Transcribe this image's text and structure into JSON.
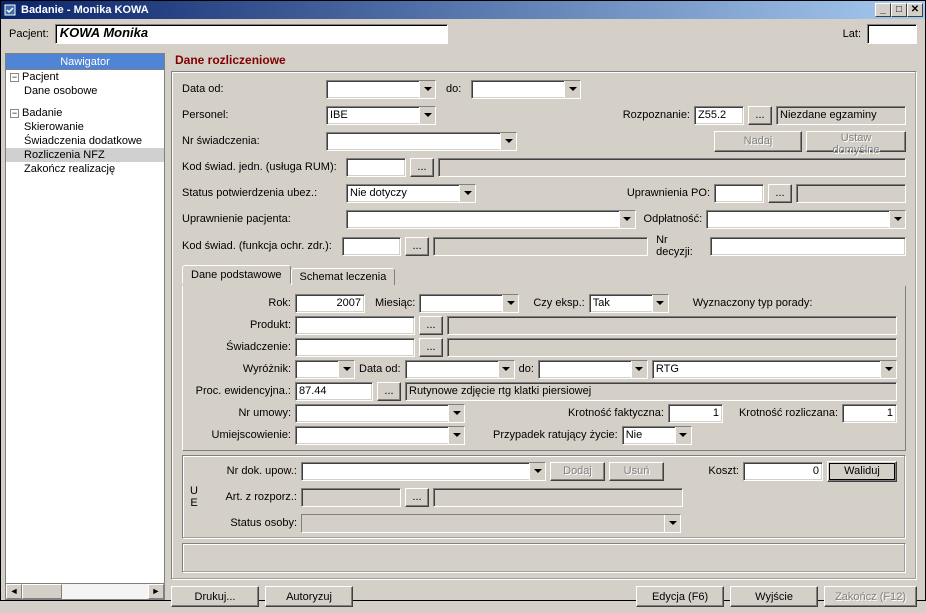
{
  "window": {
    "title": "Badanie - Monika KOWA"
  },
  "patient": {
    "label": "Pacjent:",
    "name": "KOWA Monika",
    "age_label": "Lat:",
    "age": ""
  },
  "navigator": {
    "header": "Nawigator",
    "groups": [
      {
        "label": "Pacjent",
        "items": [
          "Dane osobowe"
        ]
      },
      {
        "label": "Badanie",
        "items": [
          "Skierowanie",
          "Świadczenia dodatkowe",
          "Rozliczenia NFZ",
          "Zakończ realizację"
        ],
        "selected": "Rozliczenia NFZ"
      }
    ]
  },
  "section_title": "Dane rozliczeniowe",
  "form": {
    "data_od_label": "Data od:",
    "data_od": "",
    "do_label": "do:",
    "do": "",
    "personel_label": "Personel:",
    "personel": "IBE",
    "rozpoznanie_label": "Rozpoznanie:",
    "rozpoznanie_code": "Z55.2",
    "rozpoznanie_desc": "Niezdane egzaminy",
    "nr_swiadczenia_label": "Nr świadczenia:",
    "nr_swiadczenia": "",
    "nadaj_btn": "Nadaj",
    "ustaw_domyslne_btn": "Ustaw domyślne",
    "kod_swiad_jedn_label": "Kod świad. jedn. (usługa RUM):",
    "kod_swiad_jedn": "",
    "status_potw_label": "Status potwierdzenia ubez.:",
    "status_potw": "Nie dotyczy",
    "uprawnienia_po_label": "Uprawnienia PO:",
    "uprawnienia_po": "",
    "uprawnienie_pacjenta_label": "Uprawnienie pacjenta:",
    "uprawnienie_pacjenta": "",
    "odplatnosc_label": "Odpłatność:",
    "odplatnosc": "",
    "kod_swiad_funkcja_label": "Kod świad. (funkcja ochr. zdr.):",
    "kod_swiad_funkcja": "",
    "nr_decyzji_label": "Nr decyzji:",
    "nr_decyzji": ""
  },
  "tabs": {
    "t1": "Dane podstawowe",
    "t2": "Schemat leczenia"
  },
  "tab1": {
    "rok_label": "Rok:",
    "rok": "2007",
    "miesiac_label": "Miesiąc:",
    "miesiac": "",
    "czy_eksp_label": "Czy eksp.:",
    "czy_eksp": "Tak",
    "wyzn_typ_label": "Wyznaczony typ porady:",
    "wyzn_typ": "",
    "produkt_label": "Produkt:",
    "produkt": "",
    "swiadczenie_label": "Świadczenie:",
    "swiadczenie": "",
    "wyroznik_label": "Wyróżnik:",
    "wyroznik": "",
    "data_od_label": "Data od:",
    "data_od": "",
    "do_label": "do:",
    "do": "",
    "rtg": "RTG",
    "proc_ewid_label": "Proc. ewidencyjna.:",
    "proc_ewid_code": "87.44",
    "proc_ewid_desc": "Rutynowe zdjęcie rtg klatki piersiowej",
    "nr_umowy_label": "Nr umowy:",
    "nr_umowy": "",
    "krot_fakt_label": "Krotność faktyczna:",
    "krot_fakt": "1",
    "krot_rozl_label": "Krotność rozliczana:",
    "krot_rozl": "1",
    "umiejsc_label": "Umiejscowienie:",
    "umiejsc": "",
    "przypadek_label": "Przypadek ratujący życie:",
    "przypadek": "Nie"
  },
  "ue": {
    "u": "U",
    "e": "E",
    "nr_dok_label": "Nr dok. upow.:",
    "nr_dok": "",
    "dodaj_btn": "Dodaj",
    "usun_btn": "Usuń",
    "koszt_label": "Koszt:",
    "koszt": "0",
    "waliduj_btn": "Waliduj",
    "art_label": "Art. z rozporz.:",
    "art": "",
    "status_label": "Status osoby:",
    "status": ""
  },
  "footer": {
    "drukuj": "Drukuj...",
    "autoryzuj": "Autoryzuj",
    "edycja": "Edycja (F6)",
    "wyjscie": "Wyjście",
    "zakoncz": "Zakończ (F12)"
  },
  "ellipsis": "..."
}
